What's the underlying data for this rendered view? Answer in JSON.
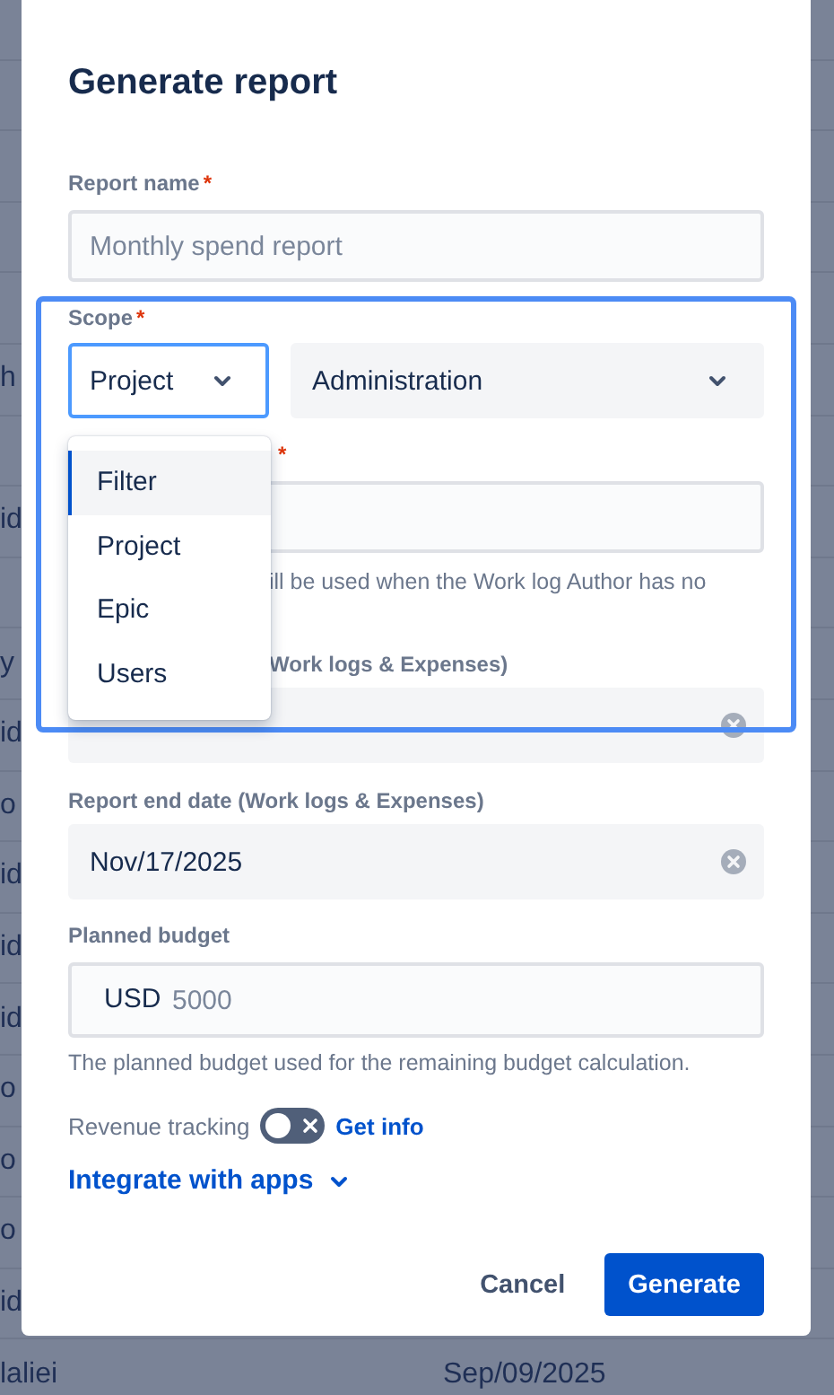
{
  "background_rows": [
    {},
    {},
    {},
    {},
    {},
    {
      "column_1": "h"
    },
    {},
    {
      "column_1": "id"
    },
    {},
    {
      "column_1": "y"
    },
    {
      "column_1": "id"
    },
    {
      "column_1": "o"
    },
    {
      "column_1": "id"
    },
    {
      "column_1": "id"
    },
    {
      "column_1": "id"
    },
    {
      "column_1": "o"
    },
    {
      "column_1": "o"
    },
    {
      "column_1": "o"
    },
    {
      "column_1": "id"
    },
    {
      "column_1": "laliei",
      "column_2": "Sep/09/2025"
    }
  ],
  "dialog": {
    "title": "Generate report",
    "report_name": {
      "label": "Report name",
      "required_mark": "*",
      "placeholder": "Monthly spend report"
    },
    "scope": {
      "label": "Scope",
      "required_mark": "*",
      "type_select": {
        "value": "Project",
        "focused": true
      },
      "project_select": {
        "value": "Administration"
      },
      "menu": [
        {
          "label": "Filter",
          "selected": true
        },
        {
          "label": "Project",
          "selected": false
        },
        {
          "label": "Epic",
          "selected": false
        },
        {
          "label": "Users",
          "selected": false
        }
      ]
    },
    "covered_field": {
      "required_mark": "*",
      "helper": "ill be used when the Work log Author has no"
    },
    "start_date": {
      "label": "Work logs & Expenses)"
    },
    "end_date": {
      "label": "Report end date (Work logs & Expenses)",
      "value": "Nov/17/2025"
    },
    "budget": {
      "label": "Planned budget",
      "currency": "USD",
      "placeholder": "5000",
      "helper": "The planned budget used for the remaining budget calculation."
    },
    "revenue": {
      "label": "Revenue tracking",
      "on": false,
      "link": "Get info"
    },
    "integrate_link": "Integrate with apps",
    "buttons": [
      {
        "label": "Cancel",
        "kind": "subtle"
      },
      {
        "label": "Generate",
        "kind": "primary"
      }
    ]
  }
}
